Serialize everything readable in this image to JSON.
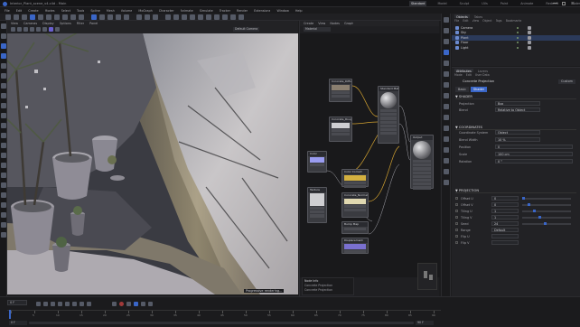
{
  "app": {
    "title": "Interior_Plant_scene_v4.c4d - Main",
    "menu": [
      "File",
      "Edit",
      "Create",
      "Modes",
      "Select",
      "Tools",
      "Spline",
      "Mesh",
      "Volume",
      "MoGraph",
      "Character",
      "Animate",
      "Simulate",
      "Tracker",
      "Render",
      "Extensions",
      "Window",
      "Help"
    ],
    "layout_tabs": [
      "Standard",
      "Model",
      "Sculpt",
      "UVs",
      "Paint",
      "Animate",
      "Redshift",
      "Nodes"
    ],
    "active_layout": "Standard"
  },
  "viewport": {
    "menu": [
      "View",
      "Cameras",
      "Display",
      "Options",
      "Filter",
      "Panel"
    ],
    "camera_label": "Default Camera",
    "status": "Progressive rendering..."
  },
  "node_editor": {
    "menu": [
      "Create",
      "View",
      "Nodes",
      "Graph"
    ],
    "tab": "Material",
    "nodes": [
      {
        "id": "tex1",
        "title": "Concrete_Diffuse"
      },
      {
        "id": "tex2",
        "title": "Concrete_Roughness"
      },
      {
        "id": "tex3",
        "title": "Texture"
      },
      {
        "id": "mat",
        "title": "Standard Material"
      },
      {
        "id": "out",
        "title": "Output"
      },
      {
        "id": "col1",
        "title": "Color"
      },
      {
        "id": "ramp",
        "title": "Color Correct"
      },
      {
        "id": "tex4",
        "title": "Concrete_Normal"
      },
      {
        "id": "bump",
        "title": "Bump Map"
      },
      {
        "id": "disp",
        "title": "Displacement"
      }
    ],
    "info": [
      "Node Info",
      "Concrete Projection",
      "Concrete Projection"
    ]
  },
  "objects_panel": {
    "tabs": [
      "Objects",
      "Takes"
    ],
    "menu": [
      "File",
      "Edit",
      "View",
      "Object",
      "Tags",
      "Bookmarks"
    ],
    "items": [
      "Camera",
      "Sky",
      "Plant",
      "Floor",
      "Light"
    ]
  },
  "attributes": {
    "tabs": [
      "Attributes",
      "Layers"
    ],
    "menu": [
      "Mode",
      "Edit",
      "User Data"
    ],
    "object_name": "Concrete Projection",
    "custom_button": "Custom",
    "sub_tabs": [
      "Basic",
      "Shader"
    ],
    "section_shader": "SHADER",
    "section_coords": "COORDINATES",
    "section_projection": "PROJECTION",
    "params": [
      {
        "label": "Projection",
        "value": "Box"
      },
      {
        "label": "Blend",
        "value": "Relative to Object"
      },
      {
        "label": "Coordinate System",
        "value": "Object"
      },
      {
        "label": "Blend Width",
        "value": "10 %"
      },
      {
        "label": "Position",
        "value": "0"
      },
      {
        "label": "Scale",
        "value": "100 cm"
      },
      {
        "label": "Rotation",
        "value": "0 °"
      }
    ],
    "proj_params": [
      {
        "label": "Offset U",
        "value": "0"
      },
      {
        "label": "Offset V",
        "value": "0"
      },
      {
        "label": "Tiling U",
        "value": "1"
      },
      {
        "label": "Tiling V",
        "value": "1"
      },
      {
        "label": "Seed",
        "value": "24"
      },
      {
        "label": "Range",
        "value": "Default"
      },
      {
        "label": "Flip U",
        "value": ""
      },
      {
        "label": "Flip V",
        "value": ""
      }
    ]
  },
  "timeline": {
    "current_frame": "0 F",
    "start": "0 F",
    "end": "90 F",
    "ticks": [
      "0",
      "5",
      "10",
      "15",
      "20",
      "25",
      "30",
      "35",
      "40",
      "45",
      "50",
      "55",
      "60",
      "65",
      "70",
      "75",
      "80",
      "85",
      "90"
    ]
  },
  "colors": {
    "accent": "#3a66c8",
    "node_header": "#2a2b30",
    "bg": "#1c1c1e"
  }
}
